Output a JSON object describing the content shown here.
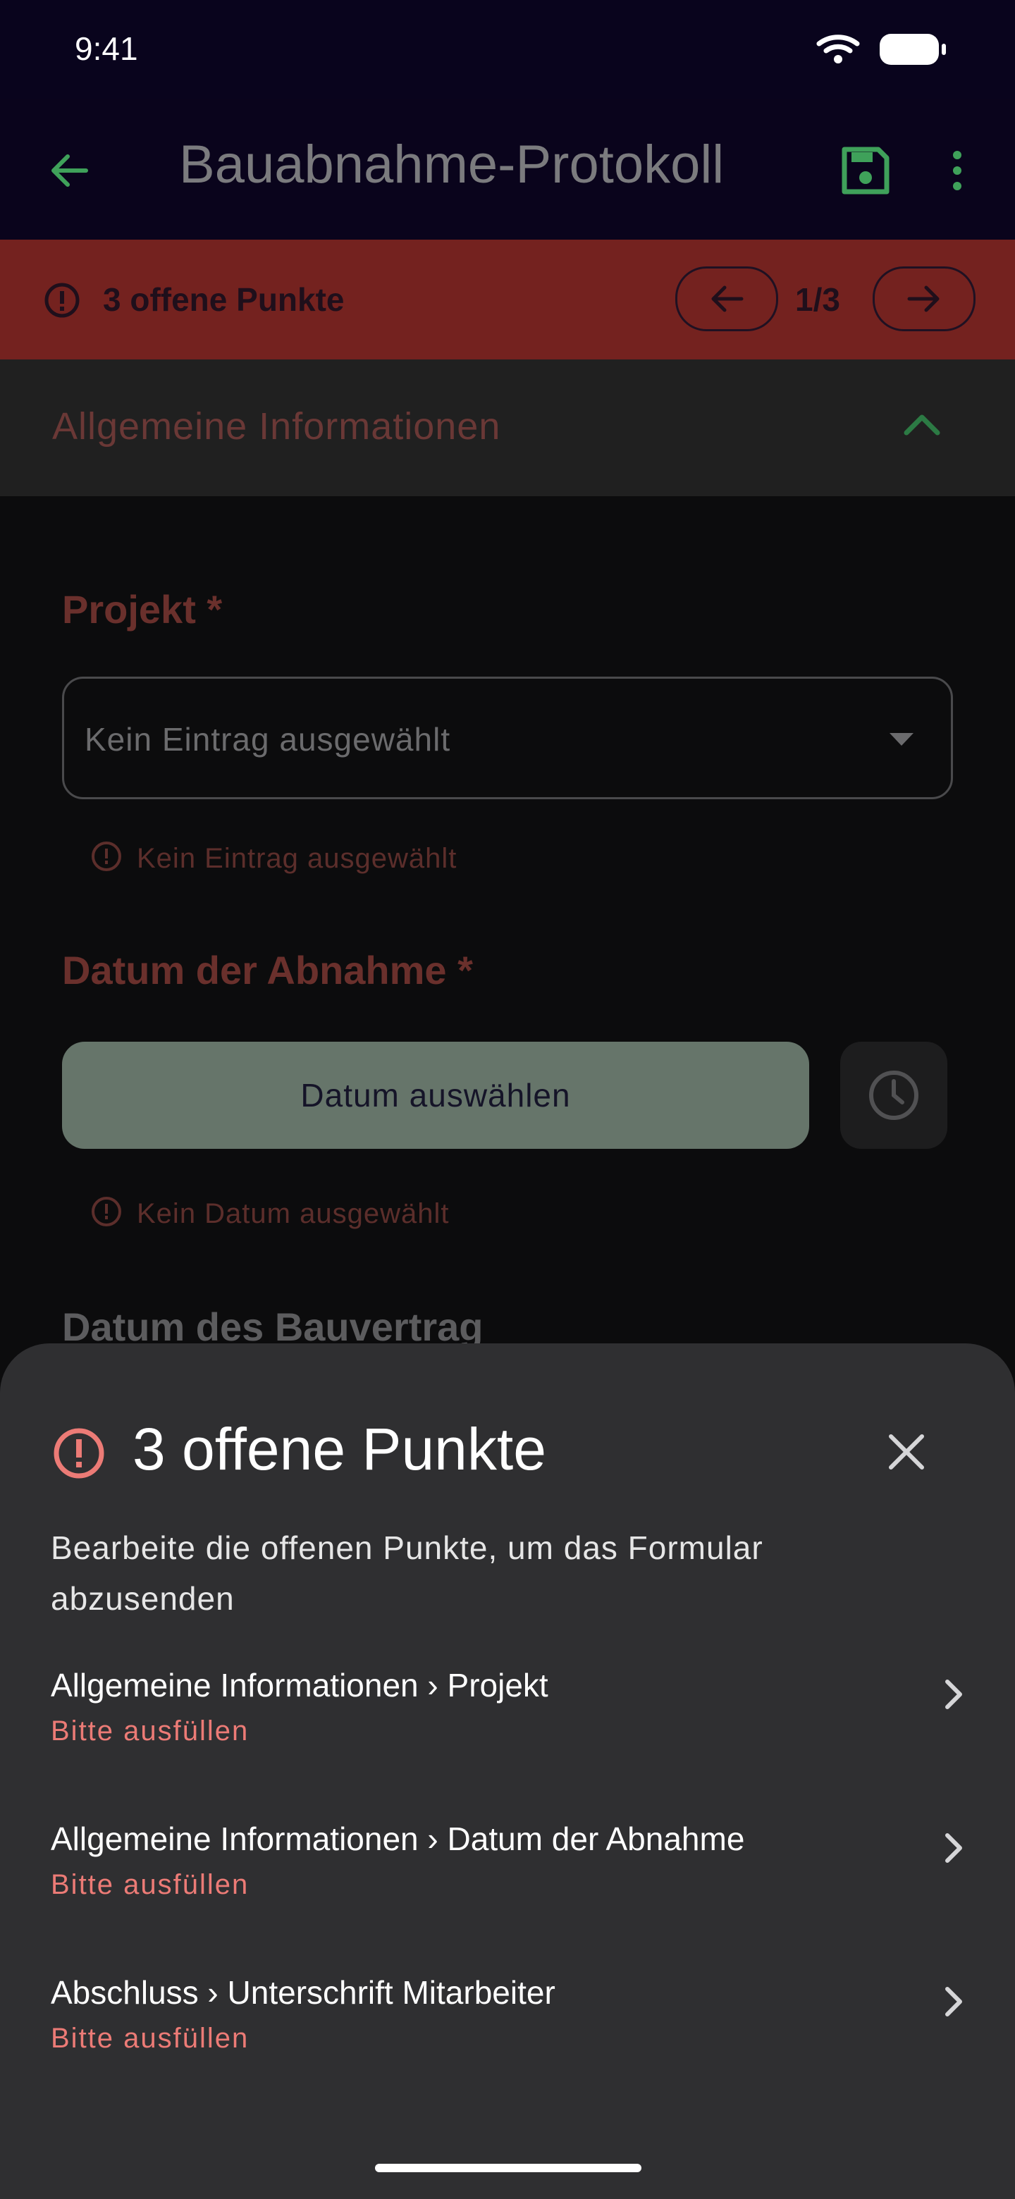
{
  "status_bar": {
    "time": "9:41"
  },
  "app_bar": {
    "title": "Bauabnahme-Protokoll",
    "icons": [
      "back-arrow-icon",
      "save-icon",
      "more-vert-icon"
    ]
  },
  "error_banner": {
    "text": "3 offene Punkte",
    "counter": "1/3"
  },
  "section": {
    "title": "Allgemeine Informationen"
  },
  "form": {
    "projekt_label": "Projekt *",
    "projekt_value": "Kein Eintrag ausgewählt",
    "projekt_error": "Kein Eintrag ausgewählt",
    "datum_label": "Datum der Abnahme *",
    "datum_button": "Datum auswählen",
    "datum_error": "Kein Datum ausgewählt",
    "bauvertrag_label": "Datum des Bauvertrag"
  },
  "sheet": {
    "title": "3 offene Punkte",
    "description": "Bearbeite die offenen Punkte, um das Formular abzusenden",
    "issues": [
      {
        "title": "Allgemeine Informationen › Projekt",
        "subtitle": "Bitte ausfüllen"
      },
      {
        "title": "Allgemeine Informationen › Datum der Abnahme",
        "subtitle": "Bitte ausfüllen"
      },
      {
        "title": "Abschluss › Unterschrift Mitarbeiter",
        "subtitle": "Bitte ausfüllen"
      }
    ]
  },
  "colors": {
    "accent_green": "#3fa15a",
    "error_red": "#ec7b76",
    "banner_red": "#74221f"
  }
}
